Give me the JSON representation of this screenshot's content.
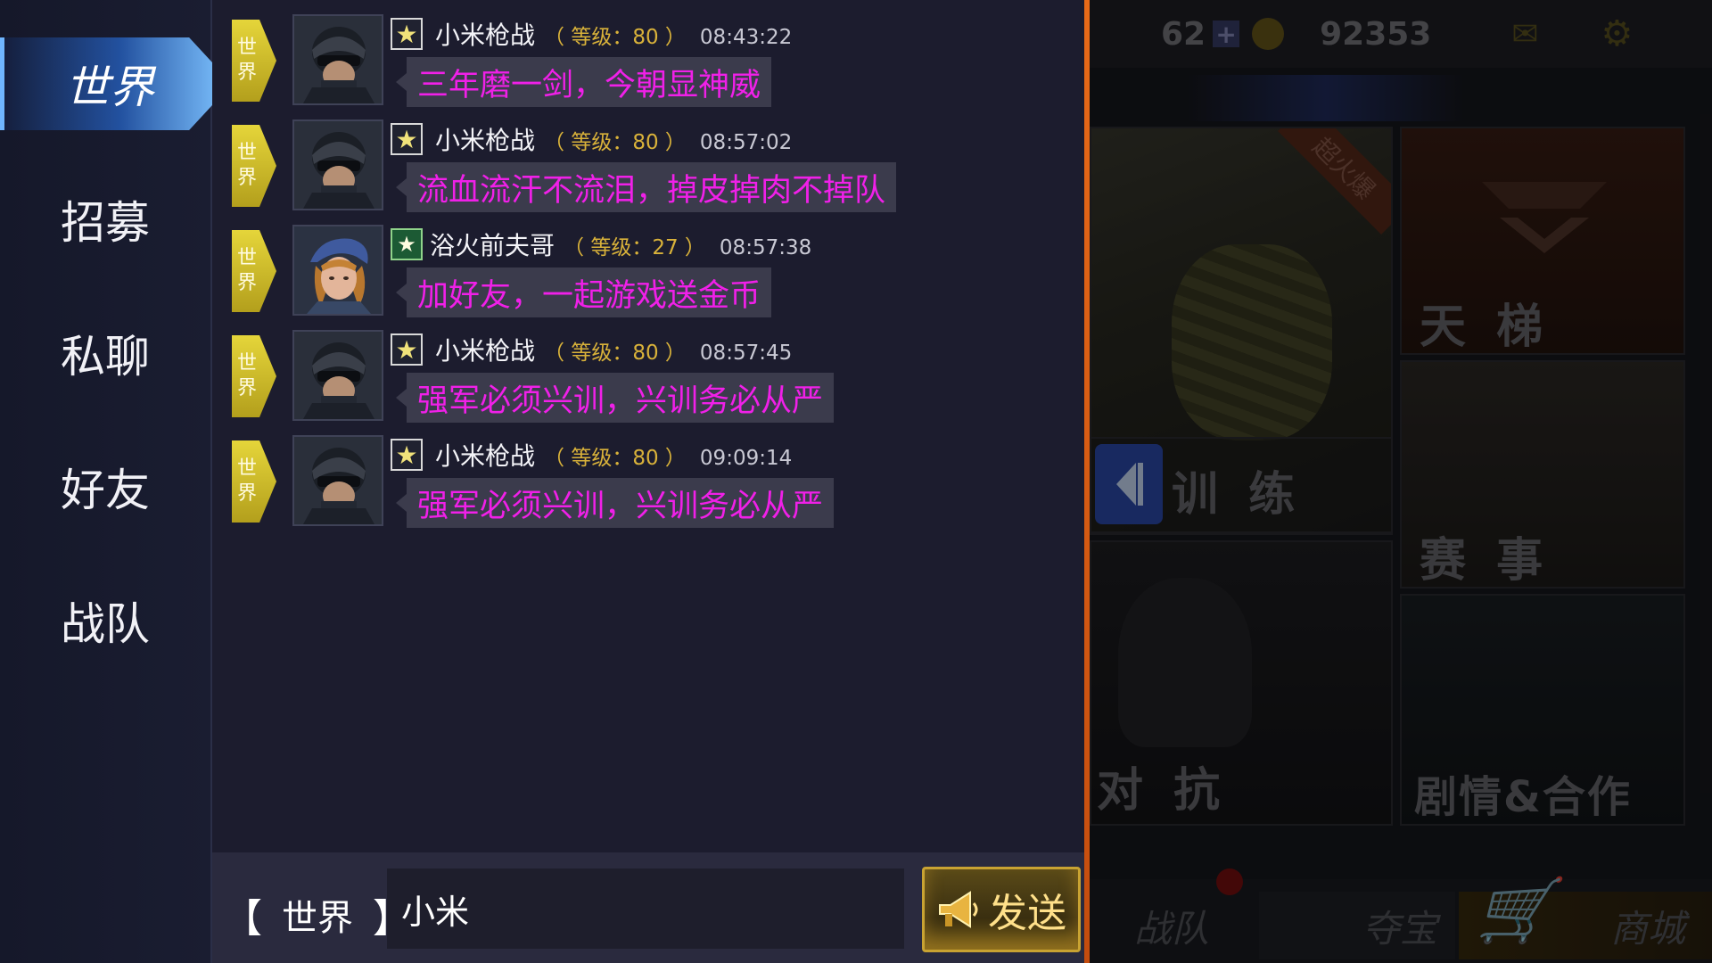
{
  "sidebar": {
    "tabs": [
      {
        "label": "世界",
        "active": true
      },
      {
        "label": "招募",
        "active": false
      },
      {
        "label": "私聊",
        "active": false
      },
      {
        "label": "好友",
        "active": false
      },
      {
        "label": "战队",
        "active": false
      }
    ]
  },
  "chat": {
    "channel_tag_lines": [
      "世",
      "界"
    ],
    "level_prefix": "等级：",
    "messages": [
      {
        "user": "小米枪战",
        "level": "80",
        "time": "08:43:22",
        "text": "三年磨一剑，今朝显神威",
        "rank_icon": "star-rank-icon"
      },
      {
        "user": "小米枪战",
        "level": "80",
        "time": "08:57:02",
        "text": "流血流汗不流泪，掉皮掉肉不掉队",
        "rank_icon": "star-rank-icon"
      },
      {
        "user": "浴火前夫哥",
        "level": "27",
        "time": "08:57:38",
        "text": "加好友，一起游戏送金币",
        "rank_icon": "green-star-rank-icon"
      },
      {
        "user": "小米枪战",
        "level": "80",
        "time": "08:57:45",
        "text": "强军必须兴训，兴训务必从严",
        "rank_icon": "star-rank-icon"
      },
      {
        "user": "小米枪战",
        "level": "80",
        "time": "09:09:14",
        "text": "强军必须兴训，兴训务必从严",
        "rank_icon": "star-rank-icon"
      }
    ]
  },
  "input_bar": {
    "bracket_left": "【",
    "channel": "世界",
    "bracket_right": "】",
    "input_value": "小米",
    "send_label": "发送"
  },
  "lobby": {
    "energy": "62",
    "coins": "92353",
    "tiles": {
      "ladder": "天 梯",
      "training": "训 练",
      "events": "赛 事",
      "versus": "对 抗",
      "story": "剧情&合作",
      "hot_badge": "超火爆"
    },
    "nav": {
      "team": "战队",
      "treasure": "夺宝",
      "shop": "商城"
    }
  },
  "colors": {
    "message_text": "#f020e8",
    "level_text": "#d9b23a",
    "channel_tag": "#d6c42c",
    "accent_orange": "#e86a18"
  }
}
